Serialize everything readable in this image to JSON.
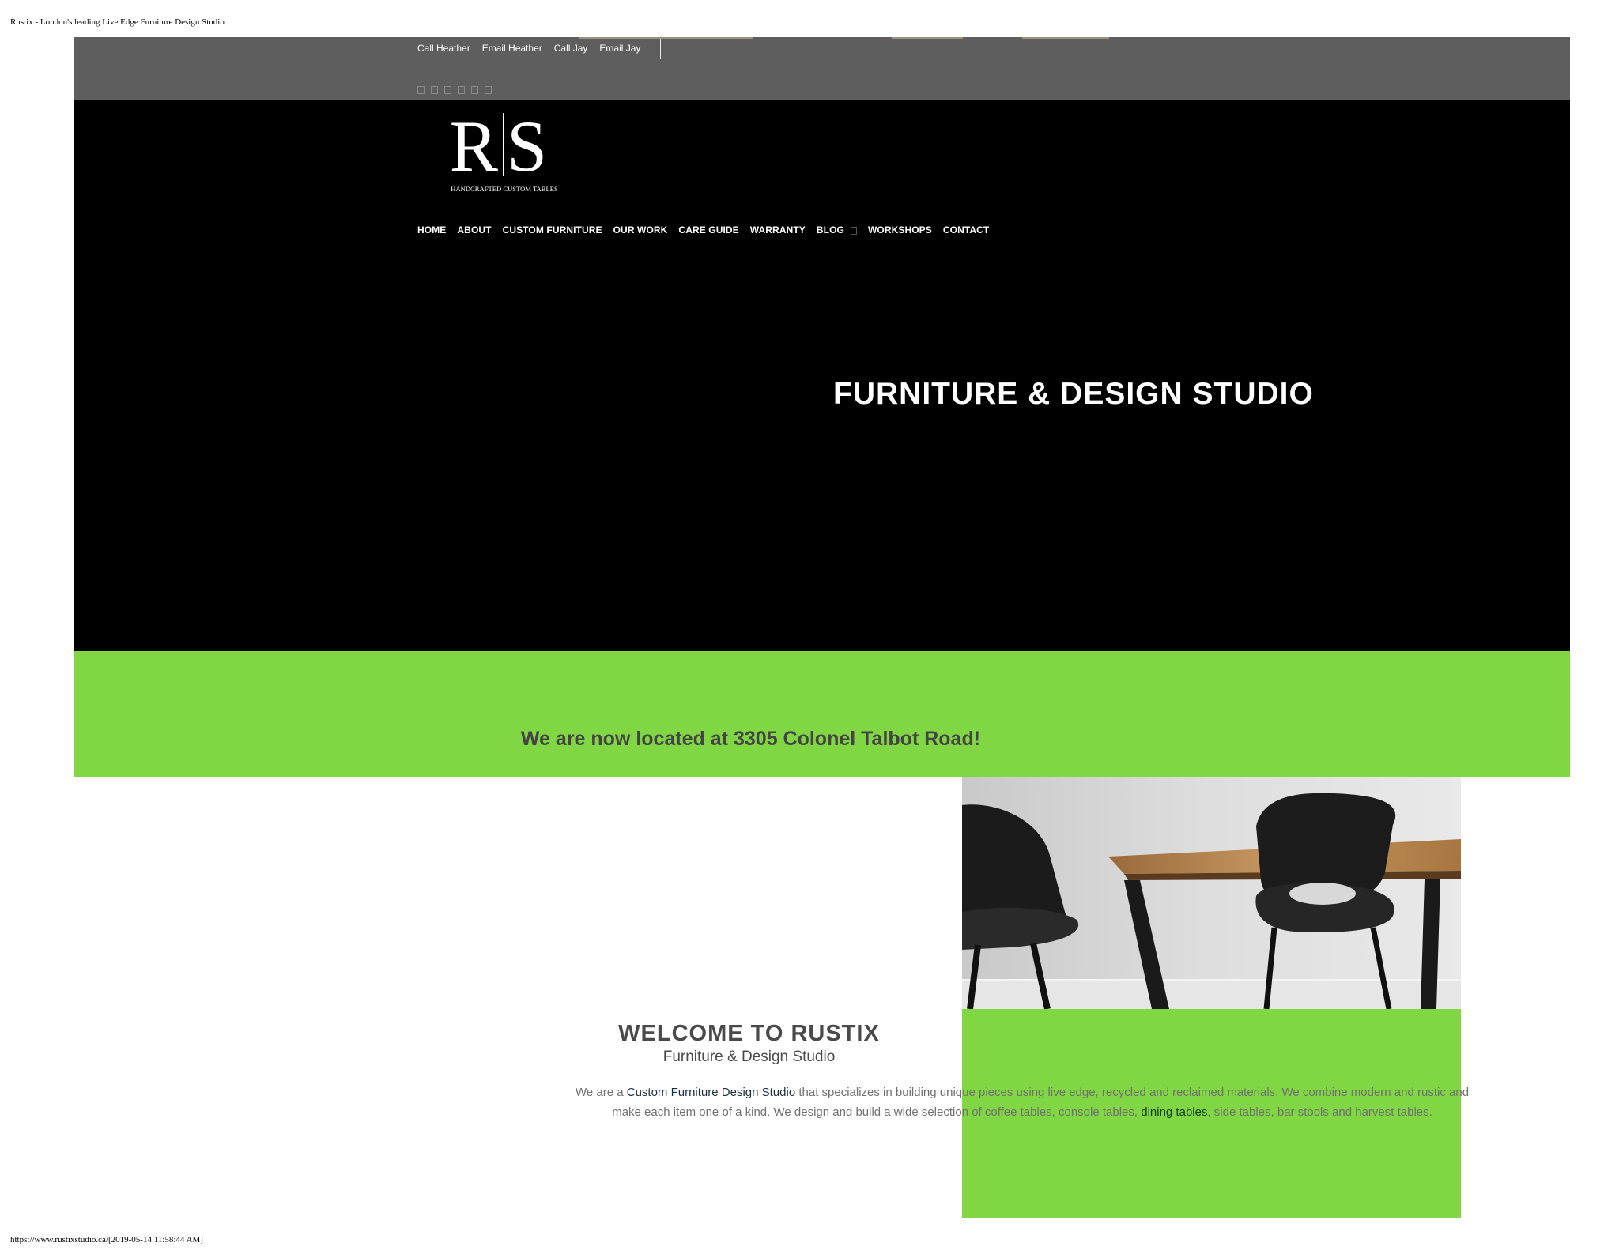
{
  "document": {
    "title": "Rustix - London's leading Live Edge Furniture Design Studio",
    "footer": "https://www.rustixstudio.ca/[2019-05-14 11:58:44 AM]"
  },
  "topbar": {
    "links": [
      "Call Heather",
      "Email Heather",
      "Call Jay",
      "Email Jay"
    ],
    "social_icons": [
      "social-icon-1",
      "social-icon-2",
      "social-icon-3",
      "social-icon-4",
      "social-icon-5",
      "social-icon-6"
    ]
  },
  "logo": {
    "mark": "R|S",
    "tagline": "HANDCRAFTED CUSTOM TABLES"
  },
  "nav": {
    "items": [
      "HOME",
      "ABOUT",
      "CUSTOM FURNITURE",
      "OUR WORK",
      "CARE GUIDE",
      "WARRANTY",
      "BLOG",
      "WORKSHOPS",
      "CONTACT"
    ]
  },
  "hero": {
    "title": "FURNITURE & DESIGN STUDIO"
  },
  "banner": {
    "text": "We are now located at 3305 Colonel Talbot Road!"
  },
  "welcome": {
    "title": "WELCOME TO RUSTIX",
    "subtitle": "Furniture & Design Studio",
    "intro_1": "We are a ",
    "intro_link_1": "Custom Furniture Design Studio",
    "intro_2": " that specializes in building unique pieces using live edge, recycled and reclaimed materials. We combine modern and rustic and make each item one of a kind. We design and build a wide selection of coffee tables, console tables, ",
    "intro_link_2": "dining tables",
    "intro_3": ", side tables, bar stools and harvest tables."
  },
  "colors": {
    "topbar": "#5f5e5e",
    "hero": "#000000",
    "accent_green": "#80d643",
    "heading_gray": "#4a4a4a"
  }
}
